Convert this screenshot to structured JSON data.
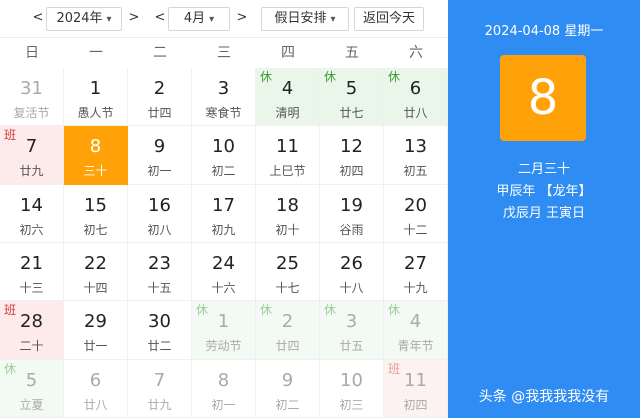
{
  "toolbar": {
    "prev_year": "<",
    "year": "2024年",
    "next_year": ">",
    "prev_month": "<",
    "month": "4月",
    "next_month": ">",
    "holiday": "假日安排",
    "today": "返回今天"
  },
  "weekdays": [
    "日",
    "一",
    "二",
    "三",
    "四",
    "五",
    "六"
  ],
  "days": [
    {
      "n": "31",
      "s": "复活节",
      "dim": true
    },
    {
      "n": "1",
      "s": "愚人节"
    },
    {
      "n": "2",
      "s": "廿四"
    },
    {
      "n": "3",
      "s": "寒食节"
    },
    {
      "n": "4",
      "s": "清明",
      "badge": "休",
      "type": "holiday"
    },
    {
      "n": "5",
      "s": "廿七",
      "badge": "休",
      "type": "holiday"
    },
    {
      "n": "6",
      "s": "廿八",
      "badge": "休",
      "type": "holiday"
    },
    {
      "n": "7",
      "s": "廿九",
      "badge": "班",
      "type": "workday"
    },
    {
      "n": "8",
      "s": "三十",
      "today": true
    },
    {
      "n": "9",
      "s": "初一"
    },
    {
      "n": "10",
      "s": "初二"
    },
    {
      "n": "11",
      "s": "上巳节"
    },
    {
      "n": "12",
      "s": "初四"
    },
    {
      "n": "13",
      "s": "初五"
    },
    {
      "n": "14",
      "s": "初六"
    },
    {
      "n": "15",
      "s": "初七"
    },
    {
      "n": "16",
      "s": "初八"
    },
    {
      "n": "17",
      "s": "初九"
    },
    {
      "n": "18",
      "s": "初十"
    },
    {
      "n": "19",
      "s": "谷雨"
    },
    {
      "n": "20",
      "s": "十二"
    },
    {
      "n": "21",
      "s": "十三"
    },
    {
      "n": "22",
      "s": "十四"
    },
    {
      "n": "23",
      "s": "十五"
    },
    {
      "n": "24",
      "s": "十六"
    },
    {
      "n": "25",
      "s": "十七"
    },
    {
      "n": "26",
      "s": "十八"
    },
    {
      "n": "27",
      "s": "十九"
    },
    {
      "n": "28",
      "s": "二十",
      "badge": "班",
      "type": "workday"
    },
    {
      "n": "29",
      "s": "廿一"
    },
    {
      "n": "30",
      "s": "廿二"
    },
    {
      "n": "1",
      "s": "劳动节",
      "badge": "休",
      "type": "holiday",
      "dim": true
    },
    {
      "n": "2",
      "s": "廿四",
      "badge": "休",
      "type": "holiday",
      "dim": true
    },
    {
      "n": "3",
      "s": "廿五",
      "badge": "休",
      "type": "holiday",
      "dim": true
    },
    {
      "n": "4",
      "s": "青年节",
      "badge": "休",
      "type": "holiday",
      "dim": true
    },
    {
      "n": "5",
      "s": "立夏",
      "badge": "休",
      "type": "holiday",
      "dim": true
    },
    {
      "n": "6",
      "s": "廿八",
      "dim": true
    },
    {
      "n": "7",
      "s": "廿九",
      "dim": true
    },
    {
      "n": "8",
      "s": "初一",
      "dim": true
    },
    {
      "n": "9",
      "s": "初二",
      "dim": true
    },
    {
      "n": "10",
      "s": "初三",
      "dim": true
    },
    {
      "n": "11",
      "s": "初四",
      "badge": "班",
      "type": "workday",
      "dim": true
    }
  ],
  "detail": {
    "date": "2024-04-08 星期一",
    "big": "8",
    "lunar": "二月三十",
    "year_gz": "甲辰年 【龙年】",
    "month_day_gz": "戊辰月 王寅日"
  },
  "watermark": "头条 @我我我我没有",
  "colors": {
    "accent_orange": "#ffa20a",
    "panel_blue": "#2f8cf2",
    "holiday_green": "#eaf6ea",
    "workday_red": "#fdeaea"
  }
}
